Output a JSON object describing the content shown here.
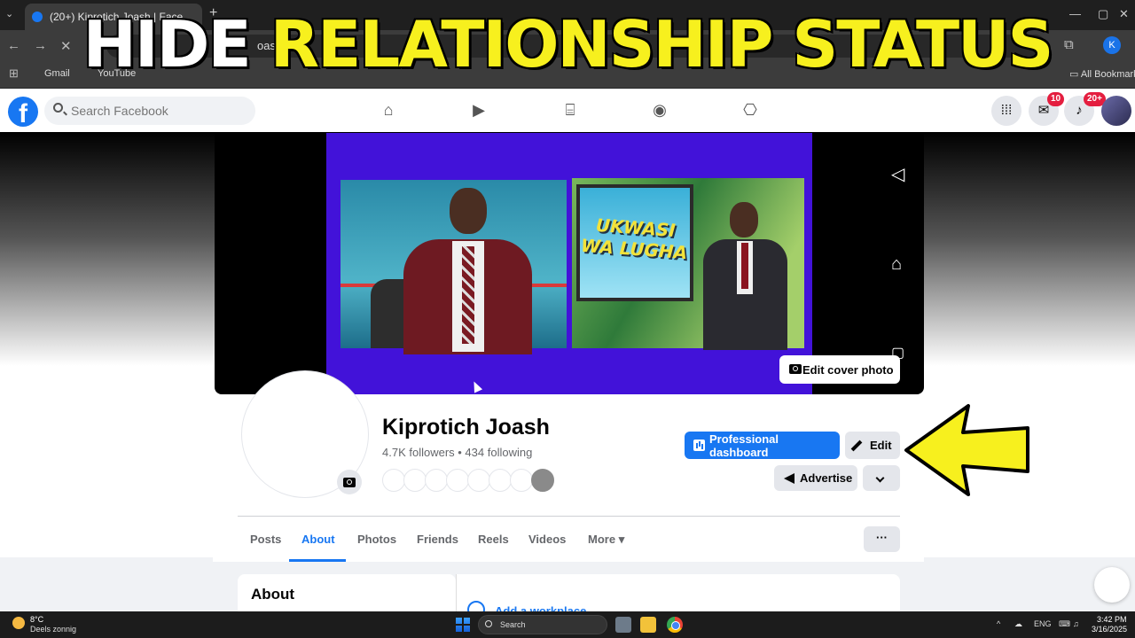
{
  "headline": {
    "part1": "HIDE ",
    "part2": "RELATIONSHIP STATUS"
  },
  "browser": {
    "tab_title": "(20+) Kiprotich Joash | Face",
    "url_fragment": "oash",
    "profile_initial": "K",
    "bookmarks": [
      "Gmail",
      "YouTube"
    ],
    "all_bookmarks": "All Bookmarks"
  },
  "facebook": {
    "logo_letter": "f",
    "search_placeholder": "Search Facebook",
    "messenger_badge": "10",
    "notifications_badge": "20+"
  },
  "cover": {
    "video_caption": "UKWASI WA LUGHA",
    "edit_cover_label": "Edit cover photo"
  },
  "profile": {
    "name": "Kiprotich Joash",
    "followers_line": "4.7K followers • 434 following",
    "friends_shown": 8,
    "professional_dashboard_label": "Professional dashboard",
    "edit_label": "Edit",
    "advertise_label": "Advertise"
  },
  "tabs": {
    "items": [
      "Posts",
      "About",
      "Photos",
      "Friends",
      "Reels",
      "Videos",
      "More"
    ],
    "active": "About",
    "more_caret": "▾",
    "dots": "···"
  },
  "about": {
    "title": "About",
    "add_workplace": "Add a workplace"
  },
  "taskbar": {
    "temperature": "8°C",
    "weather": "Deels zonnig",
    "search_label": "Search",
    "language": "ENG",
    "time": "3:42 PM",
    "date": "3/16/2025"
  },
  "colors": {
    "fb_blue": "#1877f2",
    "headline_yellow": "#f7f01e",
    "arrow_yellow": "#f7f01e",
    "badge_red": "#e41e3f"
  }
}
